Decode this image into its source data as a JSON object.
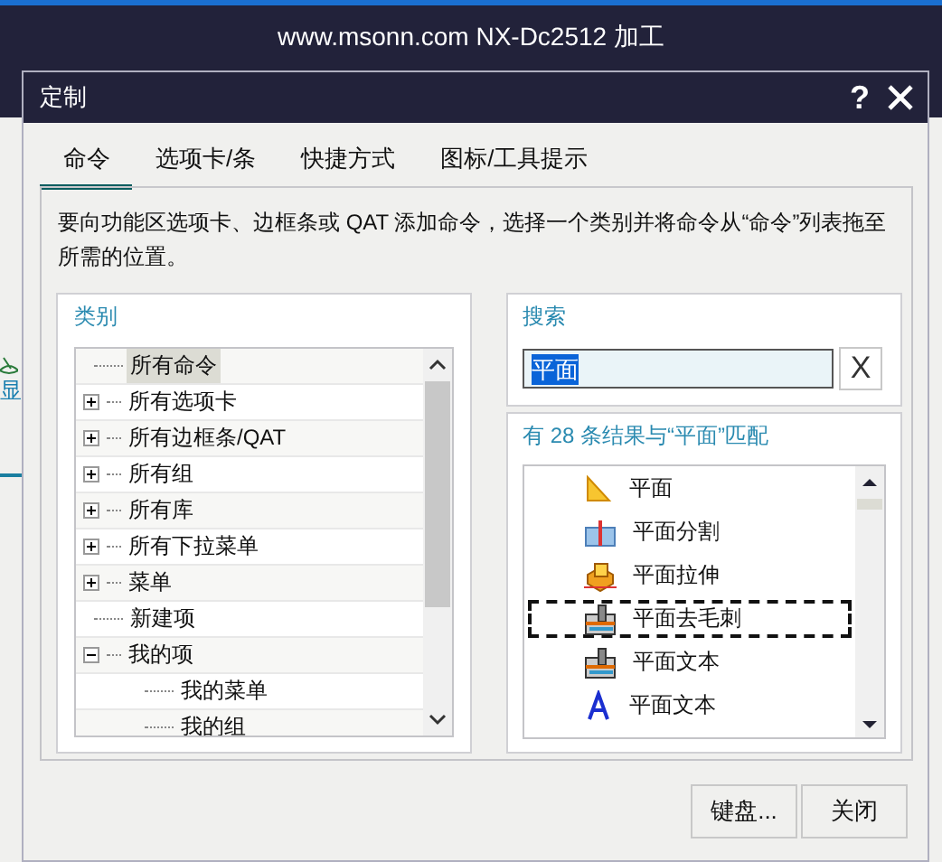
{
  "app": {
    "title": "www.msonn.com NX-Dc2512 加工",
    "side_text": "显"
  },
  "dialog": {
    "title": "定制",
    "help": "?"
  },
  "tabs": [
    {
      "label": "命令",
      "selected": true
    },
    {
      "label": "选项卡/条",
      "selected": false
    },
    {
      "label": "快捷方式",
      "selected": false
    },
    {
      "label": "图标/工具提示",
      "selected": false
    }
  ],
  "description": "要向功能区选项卡、边框条或 QAT 添加命令，选择一个类别并将命令从“命令”列表拖至所需的位置。",
  "category": {
    "label": "类别",
    "items": [
      {
        "label": "所有命令",
        "kind": "leaf",
        "selected": true
      },
      {
        "label": "所有选项卡",
        "kind": "group",
        "expanded": false,
        "selected": false
      },
      {
        "label": "所有边框条/QAT",
        "kind": "group",
        "expanded": false,
        "selected": false
      },
      {
        "label": "所有组",
        "kind": "group",
        "expanded": false,
        "selected": false
      },
      {
        "label": "所有库",
        "kind": "group",
        "expanded": false,
        "selected": false
      },
      {
        "label": "所有下拉菜单",
        "kind": "group",
        "expanded": false,
        "selected": false
      },
      {
        "label": "菜单",
        "kind": "group",
        "expanded": false,
        "selected": false
      },
      {
        "label": "新建项",
        "kind": "leaf",
        "selected": false
      },
      {
        "label": "我的项",
        "kind": "group",
        "expanded": true,
        "selected": false,
        "children": [
          {
            "label": "我的菜单",
            "kind": "leaf",
            "selected": false
          },
          {
            "label": "我的组",
            "kind": "leaf",
            "selected": false
          }
        ]
      }
    ]
  },
  "search": {
    "label": "搜索",
    "value": "平面",
    "clear": "X"
  },
  "results": {
    "summary": "有 28 条结果与“平面”匹配",
    "items": [
      {
        "label": "平面",
        "kind": "triangle",
        "focused": false
      },
      {
        "label": "平面分割",
        "kind": "split",
        "focused": false
      },
      {
        "label": "平面拉伸",
        "kind": "extrude",
        "focused": false
      },
      {
        "label": "平面去毛刺",
        "kind": "mill",
        "focused": true
      },
      {
        "label": "平面文本",
        "kind": "mill",
        "focused": false
      },
      {
        "label": "平面文本",
        "kind": "letter",
        "focused": false
      }
    ]
  },
  "buttons": [
    "键盘...",
    "关闭"
  ]
}
